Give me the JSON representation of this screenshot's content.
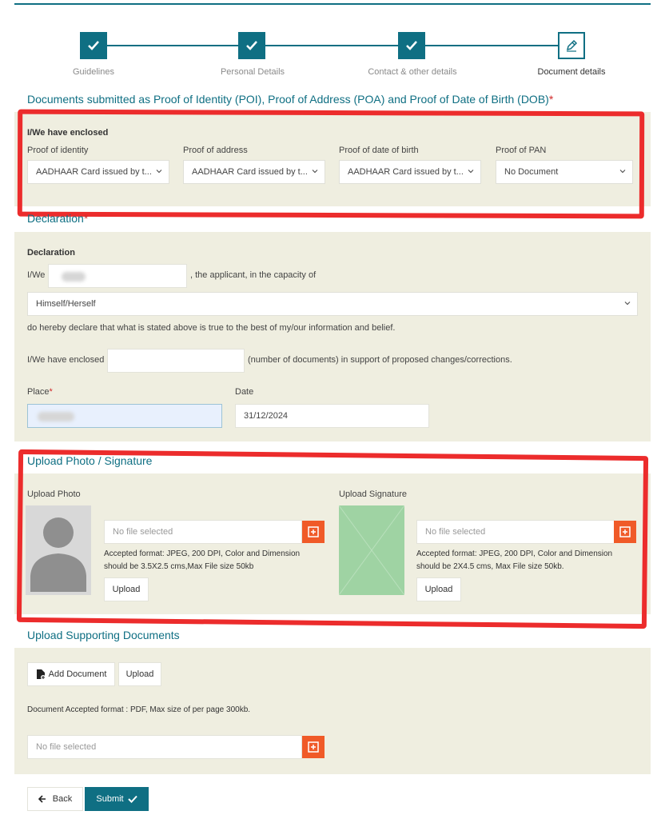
{
  "stepper": {
    "steps": [
      {
        "label": "Guidelines",
        "state": "done"
      },
      {
        "label": "Personal Details",
        "state": "done"
      },
      {
        "label": "Contact & other details",
        "state": "done"
      },
      {
        "label": "Document details",
        "state": "current"
      }
    ]
  },
  "documents": {
    "title": "Documents submitted as Proof of Identity (POI), Proof of Address (POA) and Proof of Date of Birth (DOB)",
    "required_mark": "*",
    "enclosed_label": "I/We have enclosed",
    "fields": [
      {
        "label": "Proof of identity",
        "value": "AADHAAR Card issued by t..."
      },
      {
        "label": "Proof of address",
        "value": "AADHAAR Card issued by t..."
      },
      {
        "label": "Proof of date of birth",
        "value": "AADHAAR Card issued by t..."
      },
      {
        "label": "Proof of PAN",
        "value": "No Document"
      }
    ]
  },
  "declaration": {
    "title": "Declaration",
    "required_mark": "*",
    "heading": "Declaration",
    "iwe_label": "I/We",
    "applicant_text": ", the applicant, in the capacity of",
    "capacity_value": "Himself/Herself",
    "declare_text": "do hereby declare that what is stated above is true to the best of my/our information and belief.",
    "enclosed_label": "I/We have enclosed",
    "enclosed_value": "",
    "enclosed_suffix": "(number of documents) in support of proposed changes/corrections.",
    "place_label": "Place",
    "place_required": "*",
    "date_label": "Date",
    "date_value": "31/12/2024"
  },
  "upload_photo": {
    "title": "Upload Photo / Signature",
    "photo_label": "Upload Photo",
    "photo_file": "No file selected",
    "photo_note_1": "Accepted format: JPEG, 200 DPI, Color and Dimension",
    "photo_note_2": "should be 3.5X2.5 cms,Max File size 50kb",
    "photo_upload": "Upload",
    "signature_label": "Upload Signature",
    "signature_file": "No file selected",
    "signature_note_1": "Accepted format: JPEG, 200 DPI, Color and Dimension",
    "signature_note_2": "should be 2X4.5 cms, Max File size 50kb.",
    "signature_upload": "Upload"
  },
  "supporting": {
    "title": "Upload Supporting Documents",
    "add_document": "Add Document",
    "upload": "Upload",
    "note": "Document Accepted format : PDF, Max size of per page 300kb.",
    "file": "No file selected"
  },
  "footer": {
    "back": "Back",
    "submit": "Submit"
  },
  "colors": {
    "primary": "#0f6f83",
    "panel": "#efeee0",
    "accent_orange": "#f05a28",
    "annotation_red": "#ec2c2c",
    "signature_placeholder": "#9fd3a3"
  }
}
